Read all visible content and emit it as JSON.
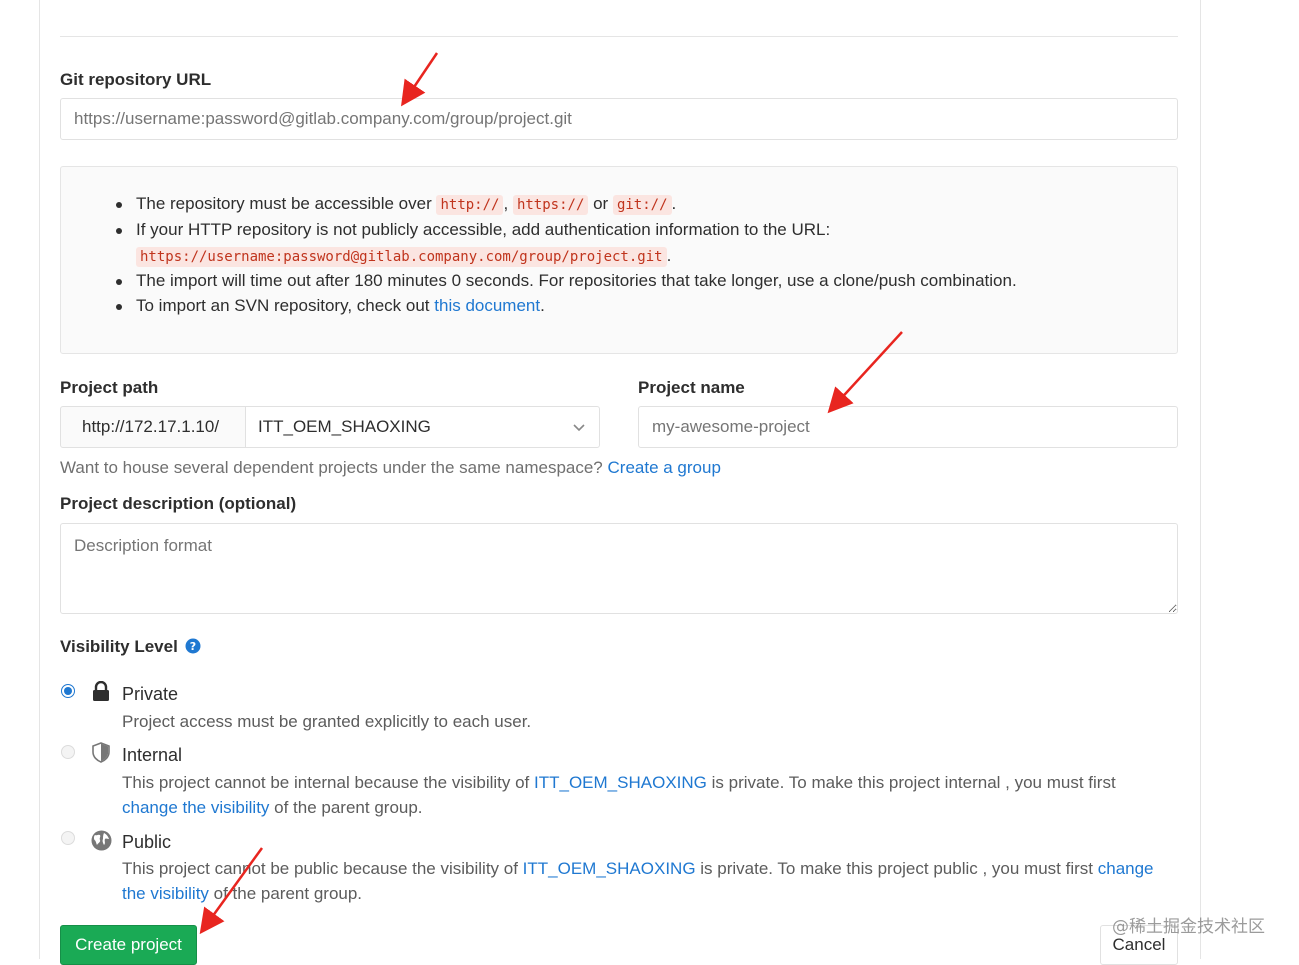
{
  "git_url": {
    "label": "Git repository URL",
    "placeholder": "https://username:password@gitlab.company.com/group/project.git"
  },
  "info": {
    "item1_text": "The repository must be accessible over ",
    "item1_code1": "http://",
    "item1_sep1": ", ",
    "item1_code2": "https://",
    "item1_sep2": " or ",
    "item1_code3": "git://",
    "item1_end": ".",
    "item2_text": "If your HTTP repository is not publicly accessible, add authentication information to the URL:",
    "item2_code": "https://username:password@gitlab.company.com/group/project.git",
    "item2_end": ".",
    "item3_text": "The import will time out after 180 minutes 0 seconds. For repositories that take longer, use a clone/push combination.",
    "item4_text": "To import an SVN repository, check out ",
    "item4_link": "this document",
    "item4_end": "."
  },
  "project_path": {
    "label": "Project path",
    "prefix": "http://172.17.1.10/",
    "namespace": "ITT_OEM_SHAOXING"
  },
  "project_name": {
    "label": "Project name",
    "placeholder": "my-awesome-project"
  },
  "group_help": {
    "text": "Want to house several dependent projects under the same namespace? ",
    "link": "Create a group"
  },
  "description": {
    "label": "Project description (optional)",
    "placeholder": "Description format"
  },
  "visibility": {
    "label": "Visibility Level",
    "options": [
      {
        "title": "Private",
        "desc": "Project access must be granted explicitly to each user."
      },
      {
        "title": "Internal",
        "desc_a": "This project cannot be internal because the visibility of ",
        "desc_link1": "ITT_OEM_SHAOXING",
        "desc_b": " is private. To make this project internal , you must first ",
        "desc_link2": "change the visibility",
        "desc_c": " of the parent group."
      },
      {
        "title": "Public",
        "desc_a": "This project cannot be public because the visibility of ",
        "desc_link1": "ITT_OEM_SHAOXING",
        "desc_b": " is private. To make this project public , you must first ",
        "desc_link2": "change the visibility",
        "desc_c": " of the parent group."
      }
    ]
  },
  "buttons": {
    "create": "Create project",
    "cancel": "Cancel"
  },
  "watermark": "@稀土掘金技术社区",
  "colors": {
    "accent": "#1f78d1",
    "create_button": "#1aaa55",
    "annotation_arrow": "#e8251f"
  }
}
